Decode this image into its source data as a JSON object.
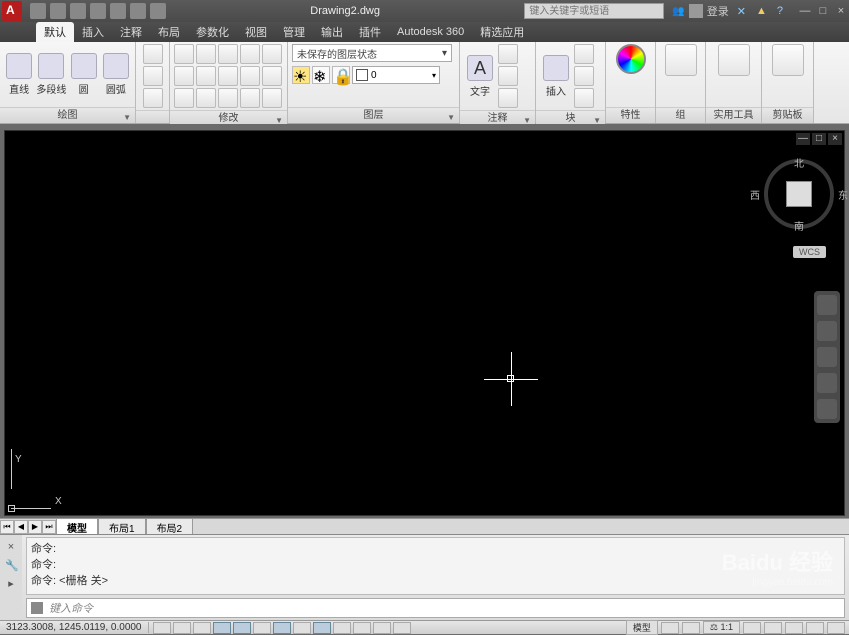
{
  "title": "Drawing2.dwg",
  "search_placeholder": "键入关键字或短语",
  "login_label": "登录",
  "window_controls": {
    "min": "—",
    "restore": "□",
    "close": "×"
  },
  "tabs": [
    "默认",
    "插入",
    "注释",
    "布局",
    "参数化",
    "视图",
    "管理",
    "输出",
    "插件",
    "Autodesk 360",
    "精选应用"
  ],
  "active_tab_index": 0,
  "ribbon": {
    "draw": {
      "title": "绘图",
      "buttons": [
        {
          "name": "line",
          "label": "直线"
        },
        {
          "name": "polyline",
          "label": "多段线"
        },
        {
          "name": "circle",
          "label": "圆"
        },
        {
          "name": "arc",
          "label": "圆弧"
        }
      ]
    },
    "modify": {
      "title": "修改"
    },
    "layers": {
      "title": "图层",
      "state_label": "未保存的图层状态",
      "layer_name": "0"
    },
    "annotate": {
      "title": "注释",
      "text_label": "文字"
    },
    "block": {
      "title": "块",
      "insert_label": "插入"
    },
    "properties": {
      "title": "特性"
    },
    "group": {
      "title": "组"
    },
    "utilities": {
      "title": "实用工具"
    },
    "clipboard": {
      "title": "剪贴板"
    }
  },
  "doc_controls": {
    "min": "—",
    "restore": "□",
    "close": "×"
  },
  "viewcube": {
    "north": "北",
    "south": "南",
    "east": "东",
    "west": "西"
  },
  "wcs_label": "WCS",
  "ucs": {
    "x": "X",
    "y": "Y"
  },
  "layout_tabs": [
    "模型",
    "布局1",
    "布局2"
  ],
  "active_layout_index": 0,
  "command": {
    "history": [
      "命令:",
      "命令:",
      "命令:  <栅格 关>"
    ],
    "prompt": "键入命令"
  },
  "status": {
    "coords": "3123.3008, 1245.0119, 0.0000",
    "model_label": "模型",
    "scale_label": "1:1"
  },
  "watermark": {
    "main": "Baidu 经验",
    "sub": "jingyan.baidu.com"
  }
}
